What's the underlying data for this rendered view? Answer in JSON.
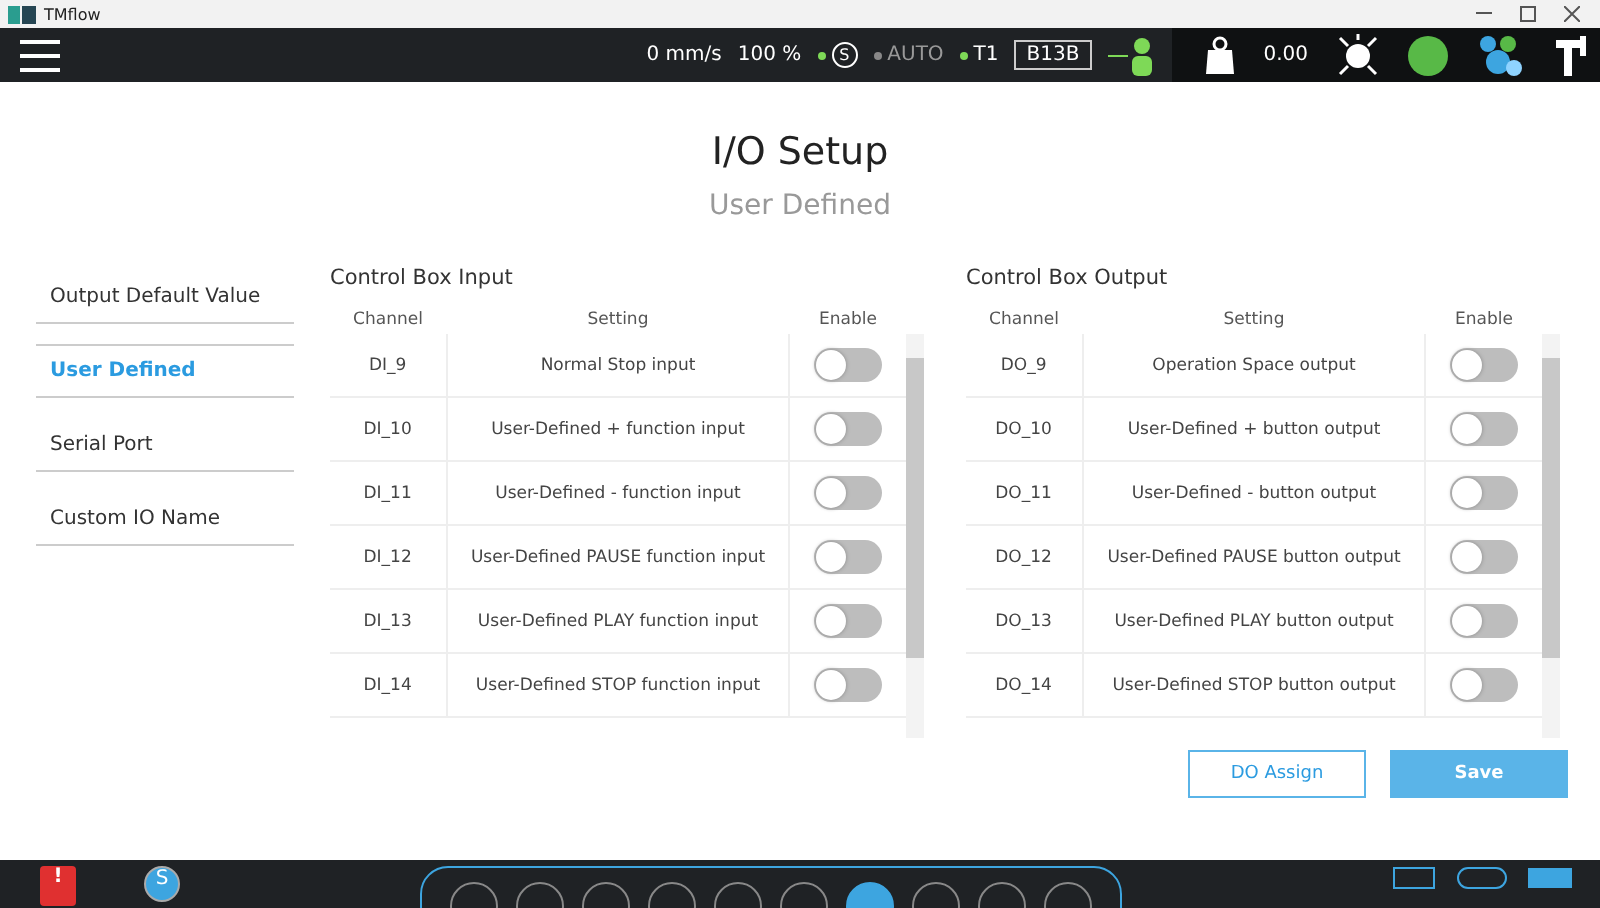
{
  "window": {
    "title": "TMflow"
  },
  "header": {
    "speed": "0 mm/s",
    "percent": "100 %",
    "modes": [
      {
        "label": "S",
        "kind": "circle",
        "active": true
      },
      {
        "label": "AUTO",
        "kind": "plain",
        "active": false
      },
      {
        "label": "T1",
        "kind": "plain",
        "active": true
      }
    ],
    "code": "B13B",
    "payload": "0.00"
  },
  "page": {
    "title": "I/O Setup",
    "subtitle": "User Defined"
  },
  "sidebar": {
    "items": [
      {
        "label": "Output Default Value",
        "selected": false
      },
      {
        "label": "User Defined",
        "selected": true
      },
      {
        "label": "Serial Port",
        "selected": false
      },
      {
        "label": "Custom IO Name",
        "selected": false
      }
    ]
  },
  "tables": [
    {
      "title": "Control Box Input",
      "columns": [
        "Channel",
        "Setting",
        "Enable"
      ],
      "rows": [
        {
          "channel": "DI_9",
          "setting": "Normal Stop input",
          "on": false
        },
        {
          "channel": "DI_10",
          "setting": "User-Defined + function input",
          "on": false
        },
        {
          "channel": "DI_11",
          "setting": "User-Defined - function input",
          "on": false
        },
        {
          "channel": "DI_12",
          "setting": "User-Defined PAUSE function input",
          "on": false
        },
        {
          "channel": "DI_13",
          "setting": "User-Defined PLAY function input",
          "on": false
        },
        {
          "channel": "DI_14",
          "setting": "User-Defined STOP function input",
          "on": false
        }
      ]
    },
    {
      "title": "Control Box Output",
      "columns": [
        "Channel",
        "Setting",
        "Enable"
      ],
      "rows": [
        {
          "channel": "DO_9",
          "setting": "Operation Space output",
          "on": false
        },
        {
          "channel": "DO_10",
          "setting": "User-Defined + button output",
          "on": false
        },
        {
          "channel": "DO_11",
          "setting": "User-Defined - button output",
          "on": false
        },
        {
          "channel": "DO_12",
          "setting": "User-Defined PAUSE button output",
          "on": false
        },
        {
          "channel": "DO_13",
          "setting": "User-Defined PLAY button output",
          "on": false
        },
        {
          "channel": "DO_14",
          "setting": "User-Defined STOP button output",
          "on": false
        }
      ]
    }
  ],
  "buttons": [
    {
      "label": "DO Assign",
      "kind": "outline"
    },
    {
      "label": "Save",
      "kind": "primary"
    }
  ],
  "bottom_bar": {
    "alert": "!",
    "status": "S"
  }
}
